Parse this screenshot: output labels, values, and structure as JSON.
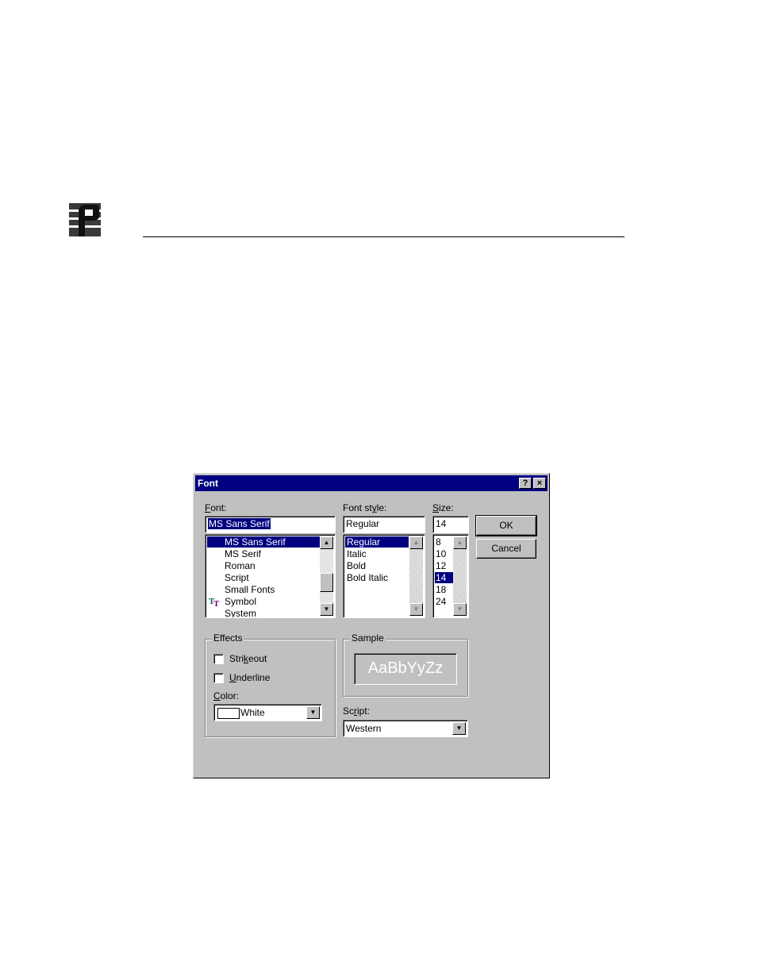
{
  "dialog": {
    "title": "Font",
    "help_button": "?",
    "close_button": "×"
  },
  "font": {
    "label_key": "F",
    "label_rest": "ont:",
    "value": "MS Sans Serif",
    "items": [
      {
        "label": "MS Sans Serif",
        "selected": true,
        "icon": ""
      },
      {
        "label": "MS Serif",
        "selected": false,
        "icon": ""
      },
      {
        "label": "Roman",
        "selected": false,
        "icon": ""
      },
      {
        "label": "Script",
        "selected": false,
        "icon": ""
      },
      {
        "label": "Small Fonts",
        "selected": false,
        "icon": ""
      },
      {
        "label": "Symbol",
        "selected": false,
        "icon": "truetype-icon"
      },
      {
        "label": "System",
        "selected": false,
        "icon": ""
      }
    ]
  },
  "font_style": {
    "label_pre": "Font st",
    "label_key": "y",
    "label_post": "le:",
    "value": "Regular",
    "items": [
      {
        "label": "Regular",
        "selected": true
      },
      {
        "label": "Italic",
        "selected": false
      },
      {
        "label": "Bold",
        "selected": false
      },
      {
        "label": "Bold Italic",
        "selected": false
      }
    ]
  },
  "size": {
    "label_key": "S",
    "label_rest": "ize:",
    "value": "14",
    "items": [
      {
        "label": "8",
        "selected": false
      },
      {
        "label": "10",
        "selected": false
      },
      {
        "label": "12",
        "selected": false
      },
      {
        "label": "14",
        "selected": true
      },
      {
        "label": "18",
        "selected": false
      },
      {
        "label": "24",
        "selected": false
      }
    ]
  },
  "buttons": {
    "ok": "OK",
    "cancel": "Cancel"
  },
  "effects": {
    "title": "Effects",
    "strikeout_pre": "Stri",
    "strikeout_key": "k",
    "strikeout_post": "eout",
    "strikeout_checked": false,
    "underline_key": "U",
    "underline_rest": "nderline",
    "underline_checked": false,
    "color_key": "C",
    "color_rest": "olor:",
    "color_value": "White",
    "color_swatch": "#ffffff"
  },
  "sample": {
    "title": "Sample",
    "text": "AaBbYyZz"
  },
  "script": {
    "label_pre": "Sc",
    "label_key": "r",
    "label_post": "ipt:",
    "value": "Western"
  },
  "colors": {
    "titlebar": "#000080",
    "face": "#c0c0c0",
    "highlight": "#000080"
  }
}
